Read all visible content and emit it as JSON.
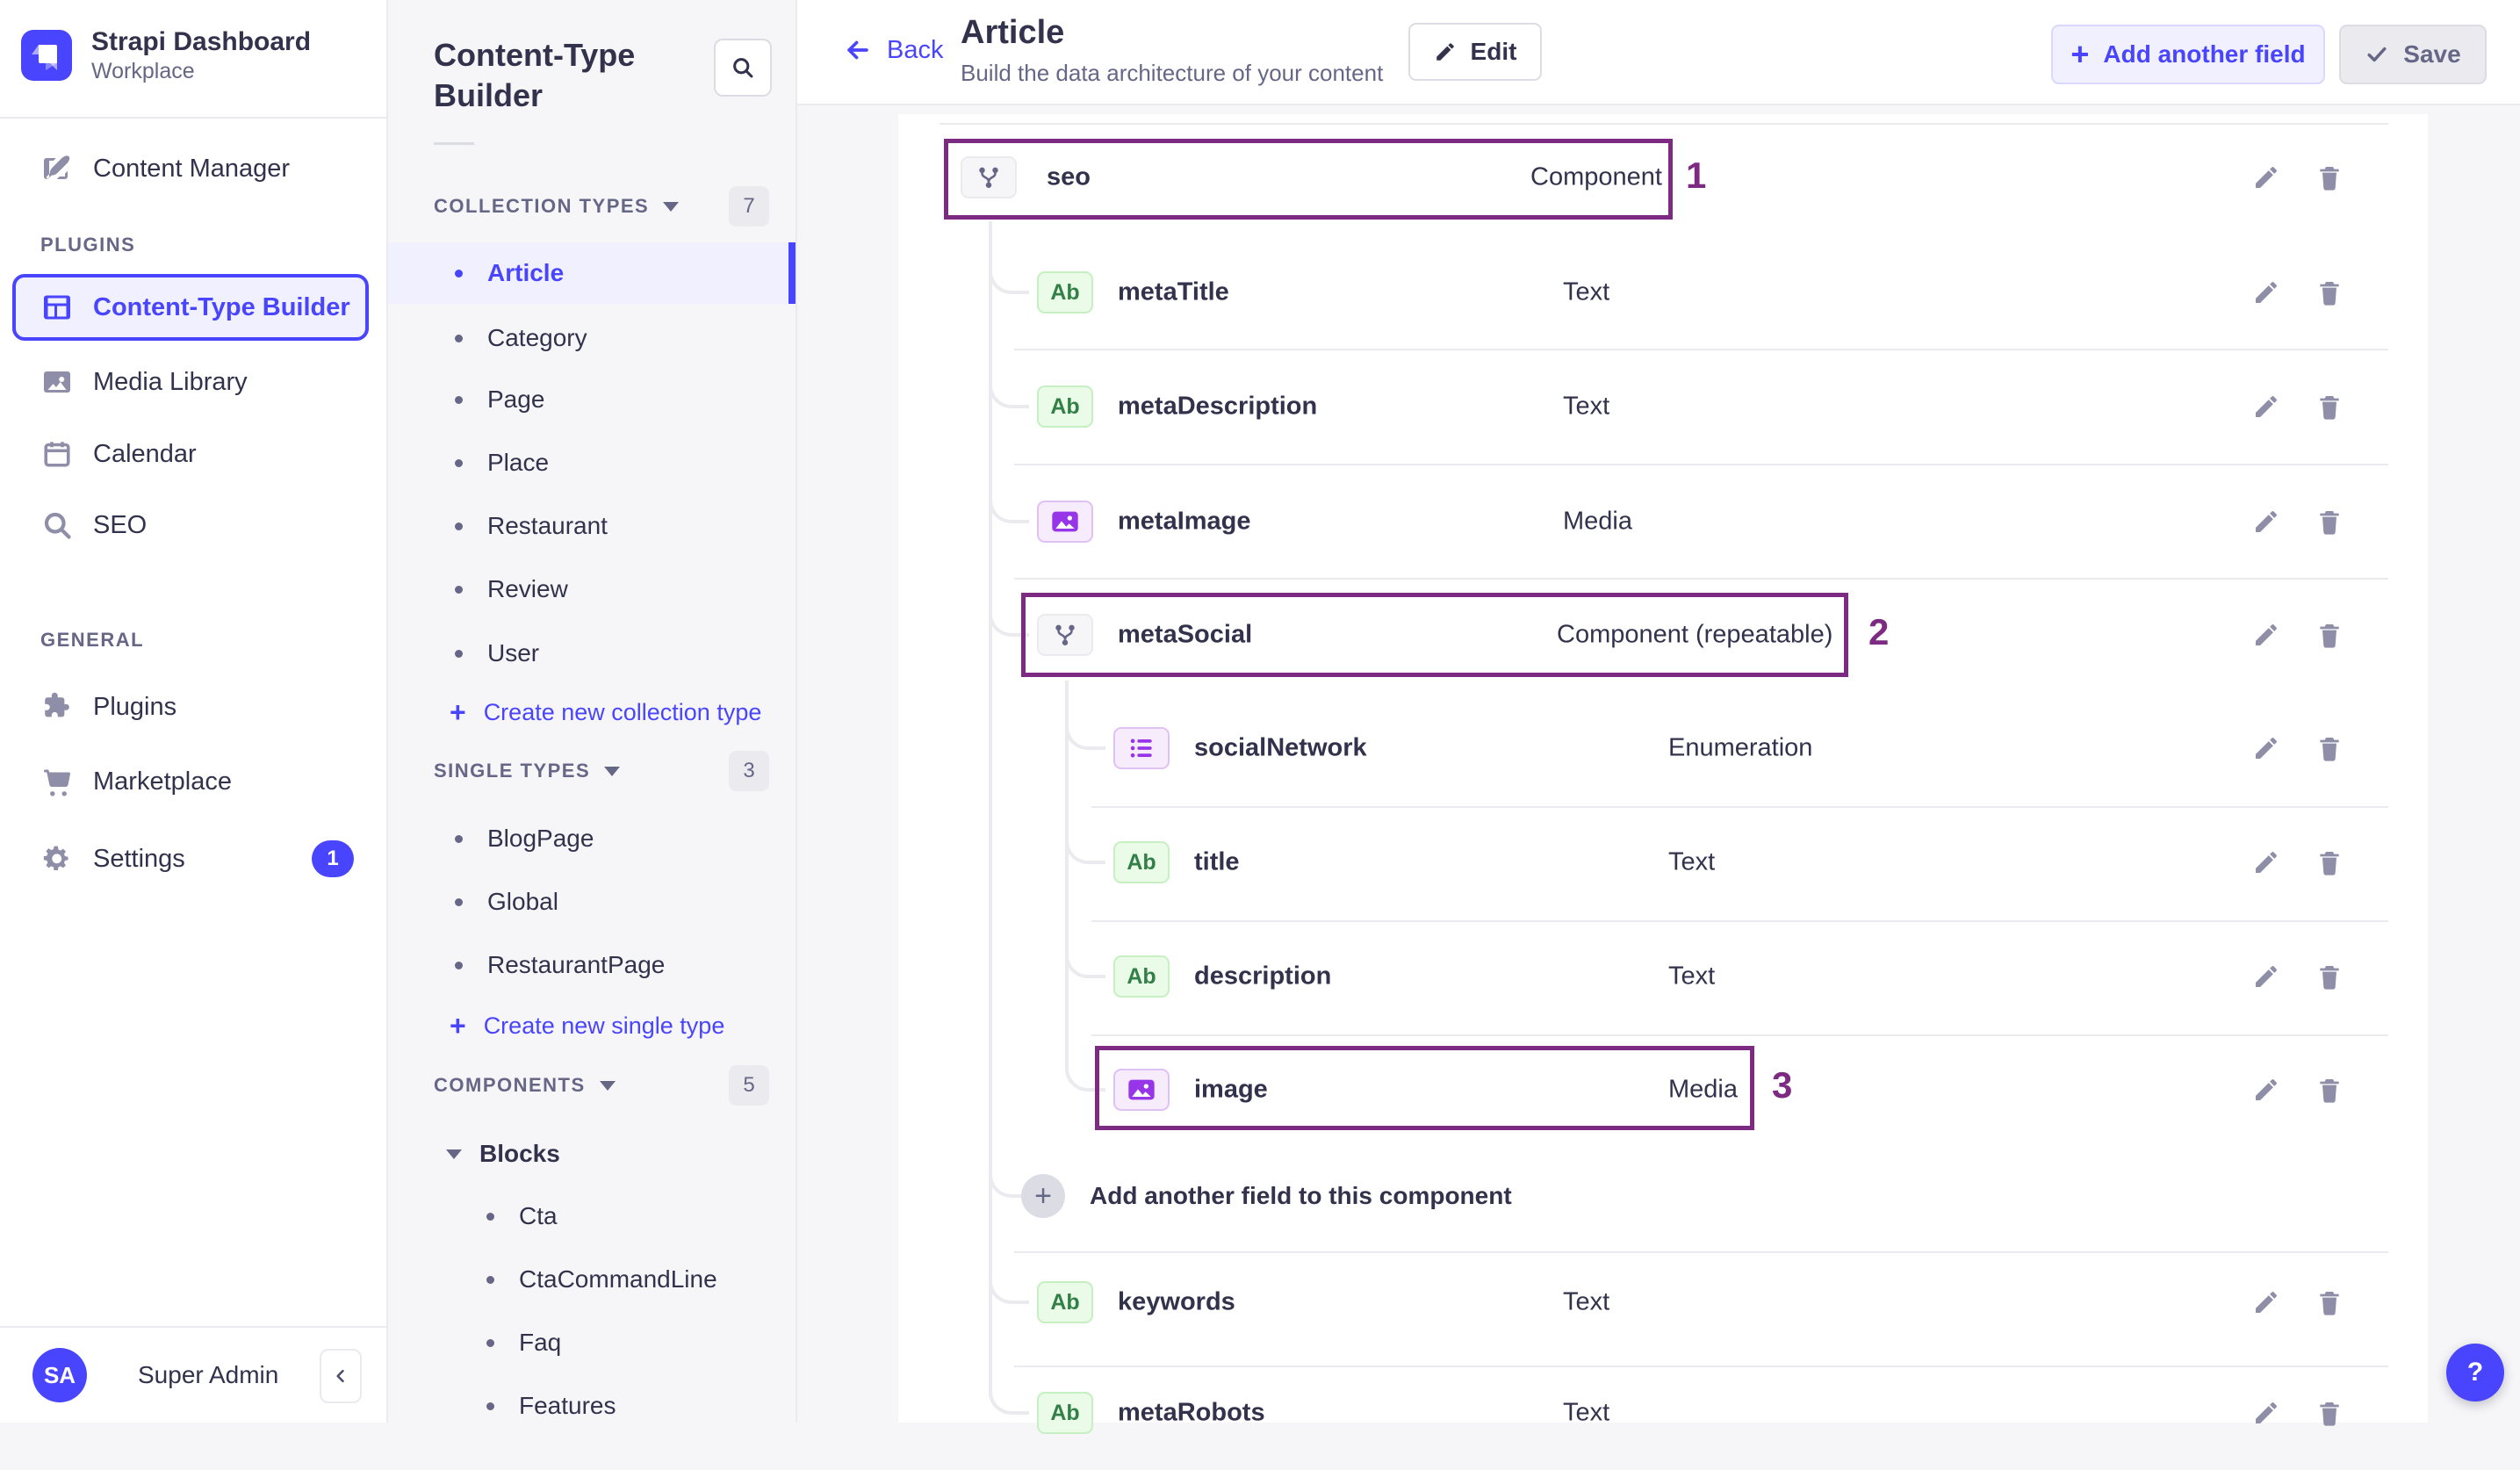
{
  "brand": {
    "title": "Strapi Dashboard",
    "subtitle": "Workplace"
  },
  "sidebar": {
    "content_manager": "Content Manager",
    "plugins_header": "PLUGINS",
    "content_type_builder": "Content-Type Builder",
    "media_library": "Media Library",
    "calendar": "Calendar",
    "seo": "SEO",
    "general_header": "GENERAL",
    "plugins": "Plugins",
    "marketplace": "Marketplace",
    "settings": "Settings",
    "settings_badge": "1",
    "user_initials": "SA",
    "user_name": "Super Admin"
  },
  "subnav": {
    "title": "Content-Type Builder",
    "collection_header": "COLLECTION TYPES",
    "collection_count": "7",
    "collection_items": [
      "Article",
      "Category",
      "Page",
      "Place",
      "Restaurant",
      "Review",
      "User"
    ],
    "create_collection": "Create new collection type",
    "single_header": "SINGLE TYPES",
    "single_count": "3",
    "single_items": [
      "BlogPage",
      "Global",
      "RestaurantPage"
    ],
    "create_single": "Create new single type",
    "components_header": "COMPONENTS",
    "components_count": "5",
    "component_group": "Blocks",
    "component_items": [
      "Cta",
      "CtaCommandLine",
      "Faq",
      "Features"
    ]
  },
  "header": {
    "back": "Back",
    "title": "Article",
    "subtitle": "Build the data architecture of your content",
    "edit": "Edit",
    "add_field": "Add another field",
    "save": "Save"
  },
  "fields": [
    {
      "name": "seo",
      "type": "Component",
      "annotation": "1"
    },
    {
      "name": "metaTitle",
      "type": "Text"
    },
    {
      "name": "metaDescription",
      "type": "Text"
    },
    {
      "name": "metaImage",
      "type": "Media"
    },
    {
      "name": "metaSocial",
      "type": "Component (repeatable)",
      "annotation": "2"
    },
    {
      "name": "socialNetwork",
      "type": "Enumeration"
    },
    {
      "name": "title",
      "type": "Text"
    },
    {
      "name": "description",
      "type": "Text"
    },
    {
      "name": "image",
      "type": "Media",
      "annotation": "3"
    },
    {
      "name": "keywords",
      "type": "Text"
    },
    {
      "name": "metaRobots",
      "type": "Text"
    }
  ],
  "text_icon_label": "Ab",
  "add_component_field": "Add another field to this component",
  "help_label": "?",
  "colors": {
    "primary": "#4945FF",
    "annotation": "#7D2B82",
    "text_field_green": "#328048",
    "purple_field": "#9736E8"
  }
}
